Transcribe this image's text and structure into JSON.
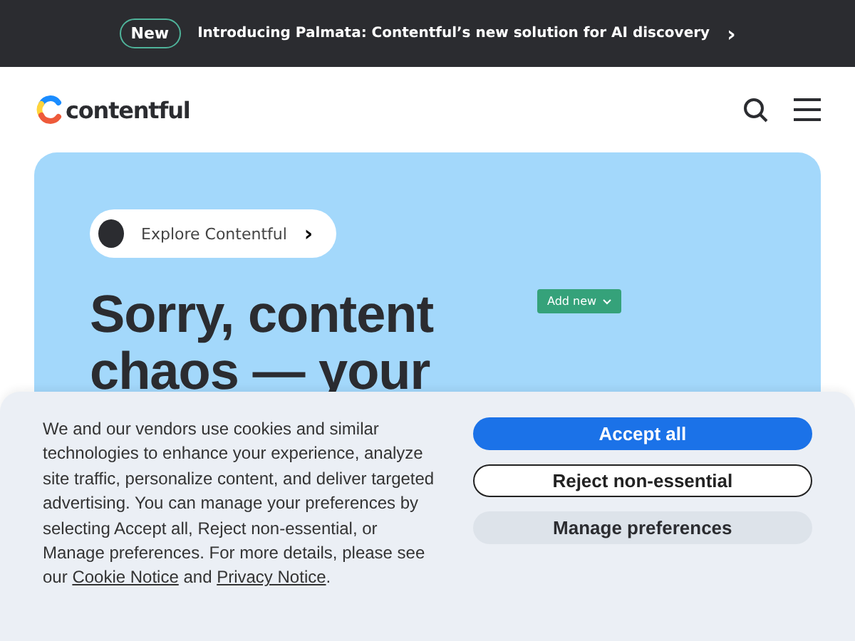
{
  "announcement": {
    "badge": "New",
    "text": "Introducing Palmata: Contentful’s new solution for AI discovery",
    "arrow": "›"
  },
  "header": {
    "logo_text": "contentful"
  },
  "hero": {
    "pill": {
      "label": "Explore Contentful",
      "arrow": "›"
    },
    "headline": "Sorry, content chaos — your",
    "ui_button": "Add new"
  },
  "cookie_banner": {
    "text_before": "We and our vendors use cookies and similar technologies to enhance your experience, analyze site traffic, personalize content, and deliver targeted advertising. You can manage your preferences by selecting Accept all, Reject non-essential, or Manage preferences. For more details, please see our ",
    "link_1": "Cookie Notice",
    "text_middle": " and ",
    "link_2": "Privacy Notice",
    "text_after": ".",
    "buttons": [
      {
        "label": "Accept all",
        "kind": "primary"
      },
      {
        "label": "Reject non-essential",
        "kind": "outline"
      },
      {
        "label": "Manage preferences",
        "kind": "secondary"
      }
    ]
  }
}
